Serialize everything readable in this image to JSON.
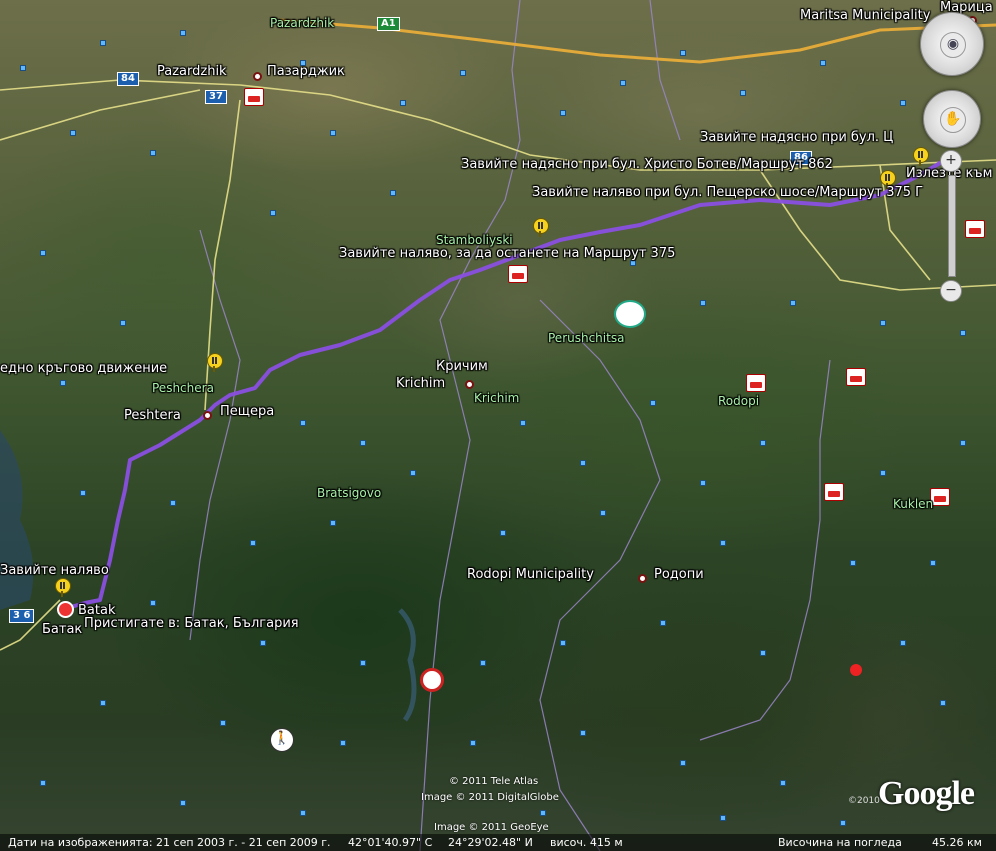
{
  "labels": {
    "pazardzhik_en": "Pazardzhik",
    "pazardzhik_green": "Pazardzhik",
    "pazardzhik_bg": "Пазарджик",
    "maritsa": "Maritsa Municipality",
    "maritsa_cut": "Марица",
    "route_top": "Завийте надясно при бул. Ц",
    "route_botev": "Завийте надясно при бул. Христо Ботев/Маршрут 862",
    "route_exit": "Излезте към",
    "route_pesh": "Завийте наляво при бул. Пещерско шосе/Маршрут 375 Г",
    "stamboliyski": "Stamboliyski",
    "route_375": "Завийте наляво, за да останете на Маршрут 375",
    "krichim_bg": "Кричим",
    "krichim_en": "Krichim",
    "krichim_green": "Krichim",
    "perushtitsa": "Perushchitsa",
    "roundabout": "едно кръгово движение",
    "peshchera_green": "Peshchera",
    "peshtera_en": "Peshtera",
    "peshtera_bg": "Пещера",
    "rodopi_green": "Rodopi",
    "bratsigovo": "Bratsigovo",
    "kuklen": "Kuklen",
    "rodopi_muni": "Rodopi Municipality",
    "rodopi_bg": "Родопи",
    "turn_left": "Завийте наляво",
    "batak_en": "Batak",
    "batak_bg": "Батак",
    "arrive": "Пристигате в: Батак, България"
  },
  "shields": {
    "a1": "A1",
    "r84": "84",
    "r37": "37",
    "r86": "86",
    "r36": "3 6"
  },
  "copyright": {
    "teleatlas": "© 2011 Tele Atlas",
    "digitalglobe": "Image © 2011 DigitalGlobe",
    "geoeye": "Image © 2011 GeoEye",
    "google": "Google",
    "gyear": "©2010"
  },
  "status": {
    "imagery_dates": "Дати на изображенията: 21 сеп 2003 г. - 21 сеп 2009 г.",
    "lat": "42°01'40.97\" С",
    "lon": "24°29'02.48\" И",
    "elev": "височ.  415 м",
    "eye_alt": "Височина на погледа",
    "eye_val": "45.26 км"
  },
  "nav": {
    "zoom_in": "+",
    "zoom_out": "−"
  },
  "colors": {
    "route": "#8a4fe0",
    "highway": "#e0a93a",
    "road": "#e6e08a",
    "border": "#9a86c8"
  }
}
